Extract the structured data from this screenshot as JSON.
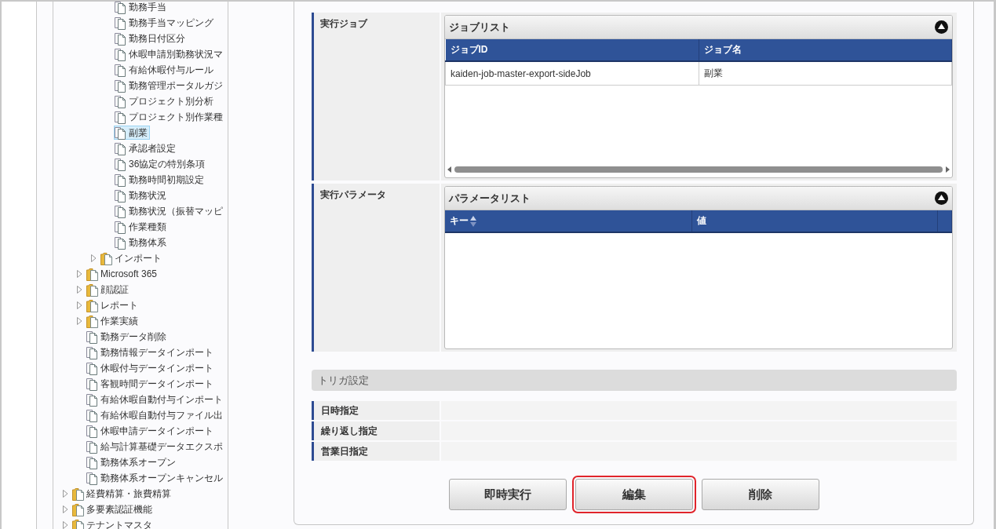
{
  "tree": {
    "items": [
      {
        "children": [
          {
            "children": [
              {
                "children": [
                  {
                    "label": "勤務手当",
                    "kind": "file",
                    "selected": false
                  },
                  {
                    "label": "勤務手当マッピング",
                    "kind": "file",
                    "selected": false
                  },
                  {
                    "label": "勤務日付区分",
                    "kind": "file",
                    "selected": false
                  },
                  {
                    "label": "休暇申請別勤務状況マ",
                    "kind": "file",
                    "selected": false
                  },
                  {
                    "label": "有給休暇付与ルール",
                    "kind": "file",
                    "selected": false
                  },
                  {
                    "label": "勤務管理ポータルガジ",
                    "kind": "file",
                    "selected": false
                  },
                  {
                    "label": "プロジェクト別分析",
                    "kind": "file",
                    "selected": false
                  },
                  {
                    "label": "プロジェクト別作業種",
                    "kind": "file",
                    "selected": false
                  },
                  {
                    "label": "副業",
                    "kind": "file",
                    "selected": true
                  },
                  {
                    "label": "承認者設定",
                    "kind": "file",
                    "selected": false
                  },
                  {
                    "label": "36協定の特別条項",
                    "kind": "file",
                    "selected": false
                  },
                  {
                    "label": "勤務時間初期設定",
                    "kind": "file",
                    "selected": false
                  },
                  {
                    "label": "勤務状況",
                    "kind": "file",
                    "selected": false
                  },
                  {
                    "label": "勤務状況（振替マッピ",
                    "kind": "file",
                    "selected": false
                  },
                  {
                    "label": "作業種類",
                    "kind": "file",
                    "selected": false
                  },
                  {
                    "label": "勤務体系",
                    "kind": "file",
                    "selected": false
                  }
                ]
              },
              {
                "label": "インポート",
                "kind": "folder",
                "expanded": false,
                "selected": false
              }
            ]
          },
          {
            "label": "Microsoft 365",
            "kind": "folder",
            "expanded": false,
            "selected": false
          },
          {
            "label": "顔認証",
            "kind": "folder",
            "expanded": false,
            "selected": false
          },
          {
            "label": "レポート",
            "kind": "folder",
            "expanded": false,
            "selected": false
          },
          {
            "label": "作業実績",
            "kind": "folder",
            "expanded": false,
            "selected": false
          },
          {
            "label": "勤務データ削除",
            "kind": "file",
            "selected": false
          },
          {
            "label": "勤務情報データインポート",
            "kind": "file",
            "selected": false
          },
          {
            "label": "休暇付与データインポート",
            "kind": "file",
            "selected": false
          },
          {
            "label": "客観時間データインポート",
            "kind": "file",
            "selected": false
          },
          {
            "label": "有給休暇自動付与インポート",
            "kind": "file",
            "selected": false
          },
          {
            "label": "有給休暇自動付与ファイル出",
            "kind": "file",
            "selected": false
          },
          {
            "label": "休暇申請データインポート",
            "kind": "file",
            "selected": false
          },
          {
            "label": "給与計算基礎データエクスポ",
            "kind": "file",
            "selected": false
          },
          {
            "label": "勤務体系オープン",
            "kind": "file",
            "selected": false
          },
          {
            "label": "勤務体系オープンキャンセル",
            "kind": "file",
            "selected": false
          }
        ]
      },
      {
        "label": "経費精算・旅費精算",
        "kind": "folder",
        "expanded": false,
        "selected": false
      },
      {
        "label": "多要素認証機能",
        "kind": "folder",
        "expanded": false,
        "selected": false
      },
      {
        "label": "テナントマスタ",
        "kind": "folder",
        "expanded": false,
        "selected": false
      }
    ]
  },
  "execution_job": {
    "label": "実行ジョブ",
    "list": {
      "title": "ジョブリスト",
      "columns": [
        {
          "label": "ジョブID",
          "sortable": false
        },
        {
          "label": "ジョブ名",
          "sortable": false
        }
      ],
      "rows": [
        [
          "kaiden-job-master-export-sideJob",
          "副業"
        ]
      ]
    }
  },
  "execution_parameters": {
    "label": "実行パラメータ",
    "list": {
      "title": "パラメータリスト",
      "columns": [
        {
          "label": "キー",
          "sortable": true
        },
        {
          "label": "値",
          "sortable": false
        }
      ]
    }
  },
  "trigger_settings": {
    "title": "トリガ設定",
    "rows": [
      "日時指定",
      "繰り返し指定",
      "営業日指定"
    ]
  },
  "buttons": [
    {
      "label": "即時実行",
      "highlighted": false
    },
    {
      "label": "編集",
      "highlighted": true
    },
    {
      "label": "削除",
      "highlighted": false
    }
  ]
}
